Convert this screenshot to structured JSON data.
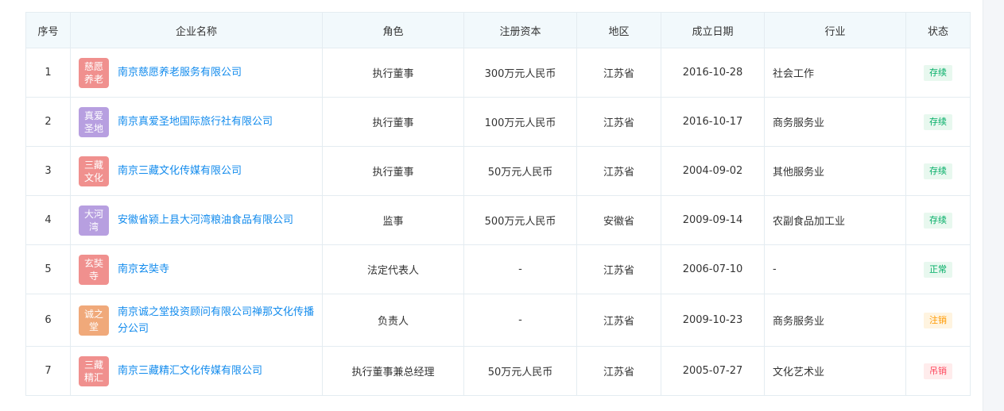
{
  "headers": {
    "seq": "序号",
    "name": "企业名称",
    "role": "角色",
    "capital": "注册资本",
    "region": "地区",
    "date": "成立日期",
    "industry": "行业",
    "status": "状态"
  },
  "rows": [
    {
      "seq": "1",
      "logo": "慈愿养老",
      "logo_color": "#f0908e",
      "name": "南京慈愿养老服务有限公司",
      "role": "执行董事",
      "capital": "300万元人民币",
      "region": "江苏省",
      "date": "2016-10-28",
      "industry": "社会工作",
      "status": "存续",
      "status_type": "green"
    },
    {
      "seq": "2",
      "logo": "真爱圣地",
      "logo_color": "#b79fe0",
      "name": "南京真爱圣地国际旅行社有限公司",
      "role": "执行董事",
      "capital": "100万元人民币",
      "region": "江苏省",
      "date": "2016-10-17",
      "industry": "商务服务业",
      "status": "存续",
      "status_type": "green"
    },
    {
      "seq": "3",
      "logo": "三藏文化",
      "logo_color": "#f0908e",
      "name": "南京三藏文化传媒有限公司",
      "role": "执行董事",
      "capital": "50万元人民币",
      "region": "江苏省",
      "date": "2004-09-02",
      "industry": "其他服务业",
      "status": "存续",
      "status_type": "green"
    },
    {
      "seq": "4",
      "logo": "大河湾",
      "logo_color": "#b79fe0",
      "name": "安徽省颍上县大河湾粮油食品有限公司",
      "role": "监事",
      "capital": "500万元人民币",
      "region": "安徽省",
      "date": "2009-09-14",
      "industry": "农副食品加工业",
      "status": "存续",
      "status_type": "green"
    },
    {
      "seq": "5",
      "logo": "玄奘寺",
      "logo_color": "#f0908e",
      "name": "南京玄奘寺",
      "role": "法定代表人",
      "capital": "-",
      "region": "江苏省",
      "date": "2006-07-10",
      "industry": "-",
      "status": "正常",
      "status_type": "green"
    },
    {
      "seq": "6",
      "logo": "诚之堂",
      "logo_color": "#f0a97a",
      "name": "南京诚之堂投资顾问有限公司禅那文化传播分公司",
      "role": "负责人",
      "capital": "-",
      "region": "江苏省",
      "date": "2009-10-23",
      "industry": "商务服务业",
      "status": "注销",
      "status_type": "orange"
    },
    {
      "seq": "7",
      "logo": "三藏精汇",
      "logo_color": "#f0908e",
      "name": "南京三藏精汇文化传媒有限公司",
      "role": "执行董事兼总经理",
      "capital": "50万元人民币",
      "region": "江苏省",
      "date": "2005-07-27",
      "industry": "文化艺术业",
      "status": "吊销",
      "status_type": "red"
    }
  ]
}
